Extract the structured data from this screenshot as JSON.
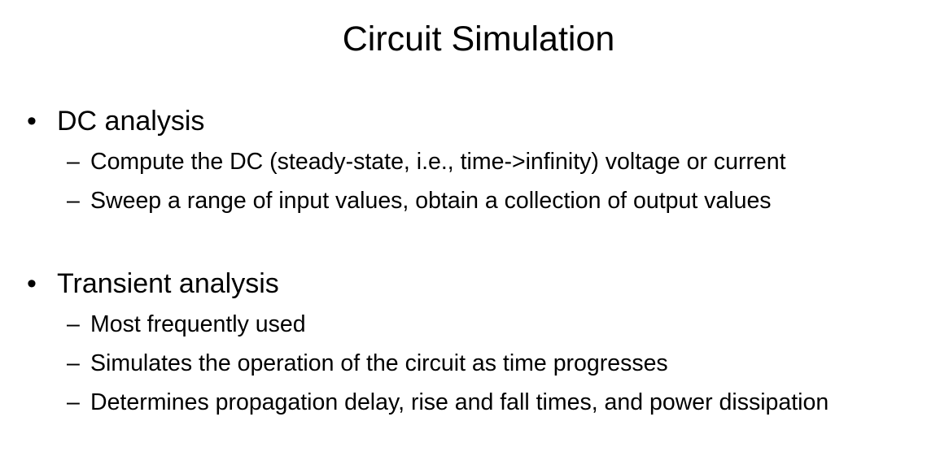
{
  "slide": {
    "title": "Circuit Simulation",
    "bullets": [
      {
        "text": "DC analysis",
        "sub": [
          "Compute the DC (steady-state, i.e., time->infinity) voltage or current",
          "Sweep a range of input values, obtain a collection of output values"
        ]
      },
      {
        "text": "Transient analysis",
        "sub": [
          "Most frequently used",
          "Simulates the operation of the circuit as time progresses",
          "Determines propagation delay, rise and fall times, and power dissipation"
        ]
      }
    ],
    "bullet_glyph": "•",
    "dash_glyph": "–"
  }
}
